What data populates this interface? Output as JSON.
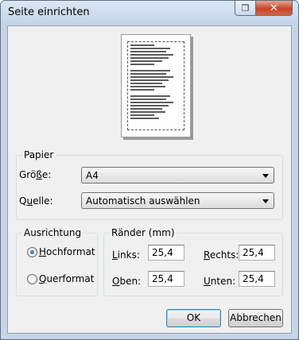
{
  "window": {
    "title": "Seite einrichten",
    "help_icon": "help-icon",
    "close_icon": "close-icon",
    "close_glyph": "✕",
    "help_glyph": "❐"
  },
  "paper": {
    "group_title": "Papier",
    "size_label_pre": "Grö",
    "size_label_u": "ß",
    "size_label_post": "e:",
    "size_value": "A4",
    "source_label_pre": "Q",
    "source_label_u": "u",
    "source_label_post": "elle:",
    "source_value": "Automatisch auswählen"
  },
  "orientation": {
    "group_title": "Ausrichtung",
    "portrait_pre": "",
    "portrait_u": "H",
    "portrait_post": "ochformat",
    "portrait_checked": true,
    "landscape_pre": "",
    "landscape_u": "Q",
    "landscape_post": "uerformat",
    "landscape_checked": false
  },
  "margins": {
    "group_title": "Ränder (mm)",
    "left_label_pre": "",
    "left_label_u": "L",
    "left_label_post": "inks:",
    "left_value": "25,4",
    "right_label_pre": "",
    "right_label_u": "R",
    "right_label_post": "echts:",
    "right_value": "25,4",
    "top_label_pre": "",
    "top_label_u": "O",
    "top_label_post": "ben:",
    "top_value": "25,4",
    "bottom_label_pre": "",
    "bottom_label_u": "U",
    "bottom_label_post": "nten:",
    "bottom_value": "25,4"
  },
  "buttons": {
    "ok": "OK",
    "cancel": "Abbrechen"
  }
}
